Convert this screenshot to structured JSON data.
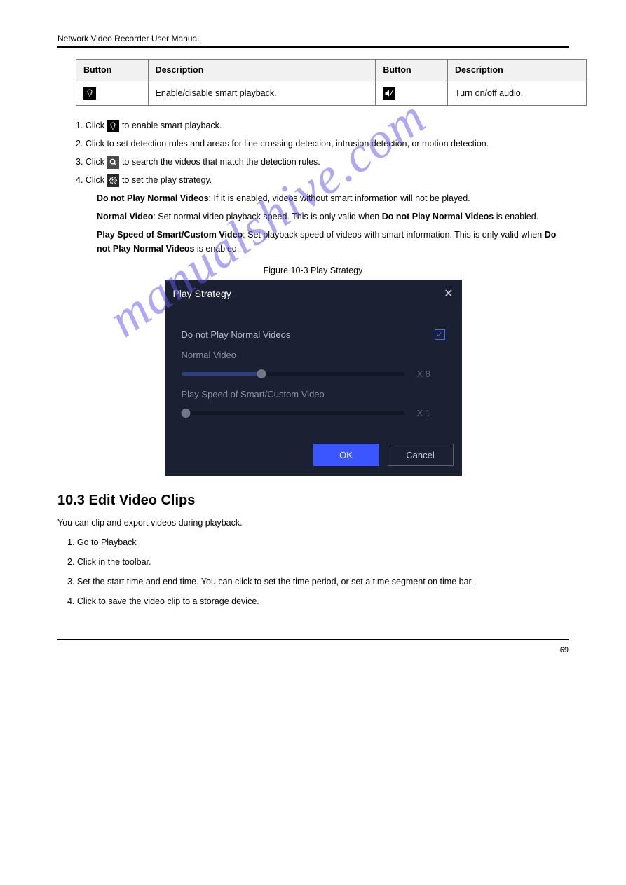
{
  "header": {
    "title": "Network Video Recorder User Manual"
  },
  "table": {
    "headers": [
      "Button",
      "Description",
      "Button",
      "Description"
    ],
    "row": {
      "cell1_icon": "smart-icon",
      "cell2": "Enable/disable smart playback.",
      "cell3_icon": "audio-off-icon",
      "cell4": "Turn on/off audio."
    }
  },
  "steps": {
    "s1a": "1. Click ",
    "s1b": " to enable smart playback.",
    "s2a": "2. Click ",
    "s2b": " to set detection rules and areas for line crossing detection, intrusion detection, or motion detection.",
    "s3a": "3. Click ",
    "s3b": " to search the videos that match the detection rules.",
    "s4a": "4. Click ",
    "s4b": " to set the play strategy.",
    "ind1": "Do not Play Normal Videos: If it is enabled, videos without smart information will not be played.",
    "ind2": "Normal Video: Set normal video playback speed. This is only valid when Do not Play Normal Videos is enabled.",
    "ind3": "Play Speed of Smart/Custom Video: Set playback speed of videos with smart information. This is only valid when Do not Play Normal Videos is enabled."
  },
  "figure": {
    "caption": "Figure 10-3 Play Strategy"
  },
  "dialog": {
    "title": "Play Strategy",
    "opt_label": "Do not Play Normal Videos",
    "normal_label": "Normal Video",
    "normal_speed": "X 8",
    "smart_label": "Play Speed of Smart/Custom Video",
    "smart_speed": "X 1",
    "ok": "OK",
    "cancel": "Cancel"
  },
  "section": {
    "heading": "10.3 Edit Video Clips",
    "p1": "You can clip and export videos during playback.",
    "s1": "1. Go to Playback",
    "s2": "2. Click  in the toolbar.",
    "s3": "3. Set the start time and end time. You can click  to set the time period, or set a time segment on time bar.",
    "s4": "4. Click  to save the video clip to a storage device."
  },
  "footer": {
    "page": "69"
  }
}
